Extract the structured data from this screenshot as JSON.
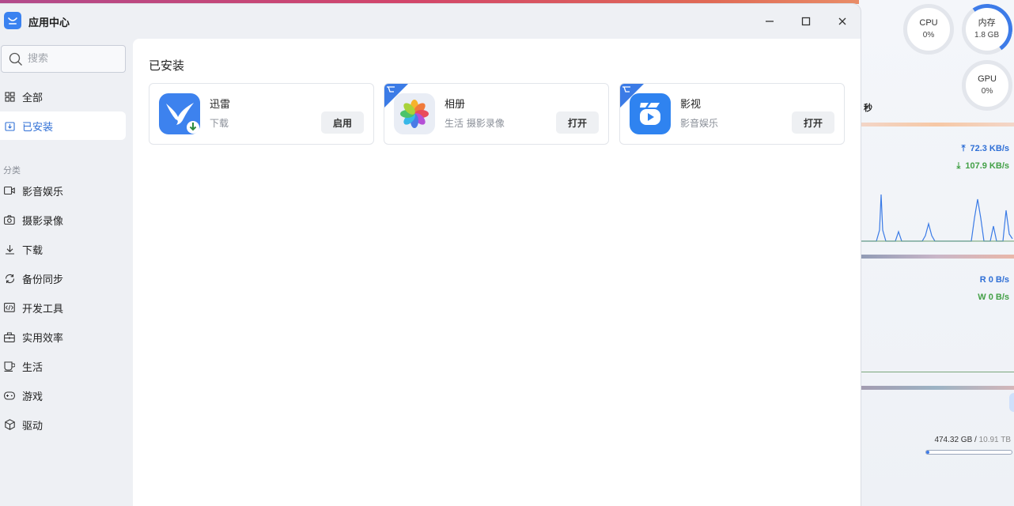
{
  "window": {
    "title": "应用中心"
  },
  "sidebar": {
    "search_placeholder": "搜索",
    "items": [
      {
        "label": "全部",
        "icon": "grid-icon"
      },
      {
        "label": "已安装",
        "icon": "installed-icon",
        "active": true
      }
    ],
    "category_heading": "分类",
    "categories": [
      {
        "label": "影音娱乐",
        "icon": "video-icon"
      },
      {
        "label": "摄影录像",
        "icon": "camera-icon"
      },
      {
        "label": "下载",
        "icon": "download-icon"
      },
      {
        "label": "备份同步",
        "icon": "sync-icon"
      },
      {
        "label": "开发工具",
        "icon": "code-icon"
      },
      {
        "label": "实用效率",
        "icon": "toolbox-icon"
      },
      {
        "label": "生活",
        "icon": "cup-icon"
      },
      {
        "label": "游戏",
        "icon": "gamepad-icon"
      },
      {
        "label": "驱动",
        "icon": "cube-icon"
      }
    ]
  },
  "main": {
    "title": "已安装",
    "apps": [
      {
        "name": "迅雷",
        "tags": "下载",
        "button": "启用",
        "icon": "xunlei-bird-icon",
        "ribbon": false
      },
      {
        "name": "相册",
        "tags": "生活 摄影录像",
        "button": "打开",
        "icon": "photos-flower-icon",
        "ribbon": true
      },
      {
        "name": "影视",
        "tags": "影音娱乐",
        "button": "打开",
        "icon": "video-play-icon",
        "ribbon": true
      }
    ]
  },
  "monitor": {
    "cpu_label": "CPU",
    "cpu_value": "0%",
    "mem_label": "内存",
    "mem_value": "1.8 GB",
    "gpu_label": "GPU",
    "gpu_value": "0%",
    "seconds_label": "秒",
    "net_up": "72.3 KB/s",
    "net_down": "107.9 KB/s",
    "disk_read": "R  0 B/s",
    "disk_write": "W  0 B/s",
    "disk_used": "474.32 GB",
    "disk_total": "10.91 TB",
    "disk_fill_fraction": 0.04
  },
  "colors": {
    "accent": "#2f6fd6",
    "ribbon": "#3b7be6",
    "up": "#2f6fd6",
    "down": "#43a047"
  }
}
